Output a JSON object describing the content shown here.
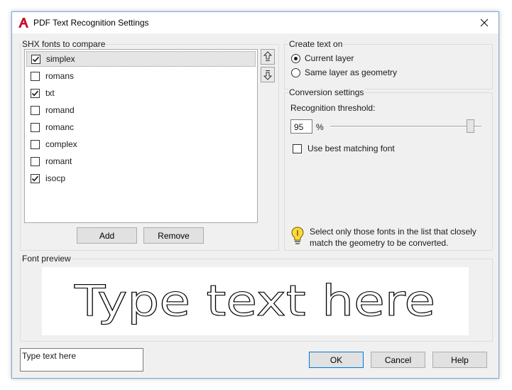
{
  "window": {
    "title": "PDF Text Recognition Settings"
  },
  "fonts_group": {
    "label": "SHX fonts to compare",
    "items": [
      {
        "label": "simplex",
        "checked": true,
        "selected": true
      },
      {
        "label": "romans",
        "checked": false,
        "selected": false
      },
      {
        "label": "txt",
        "checked": true,
        "selected": false
      },
      {
        "label": "romand",
        "checked": false,
        "selected": false
      },
      {
        "label": "romanc",
        "checked": false,
        "selected": false
      },
      {
        "label": "complex",
        "checked": false,
        "selected": false
      },
      {
        "label": "romant",
        "checked": false,
        "selected": false
      },
      {
        "label": "isocp",
        "checked": true,
        "selected": false
      }
    ],
    "add_label": "Add",
    "remove_label": "Remove"
  },
  "create_text": {
    "label": "Create text on",
    "options": [
      {
        "label": "Current layer",
        "selected": true
      },
      {
        "label": "Same layer as geometry",
        "selected": false
      }
    ]
  },
  "conversion": {
    "label": "Conversion settings",
    "threshold_label": "Recognition threshold:",
    "threshold_value": "95",
    "threshold_unit": "%",
    "threshold_fraction": 0.95,
    "best_match_label": "Use best matching font",
    "best_match_checked": false,
    "tip": "Select only those fonts in the list that closely match the geometry to be converted."
  },
  "preview": {
    "label": "Font preview",
    "sample": "Type text here"
  },
  "footer": {
    "preview_input_value": "Type text here",
    "ok_label": "OK",
    "cancel_label": "Cancel",
    "help_label": "Help"
  },
  "colors": {
    "brand": "#c8102e",
    "focus_border": "#0078d7",
    "window_bg": "#f0f0f0"
  },
  "icons": {
    "app": "autocad-logo-icon",
    "close": "close-icon",
    "move_up": "move-up-icon",
    "move_down": "move-down-icon",
    "tip": "lightbulb-icon"
  }
}
